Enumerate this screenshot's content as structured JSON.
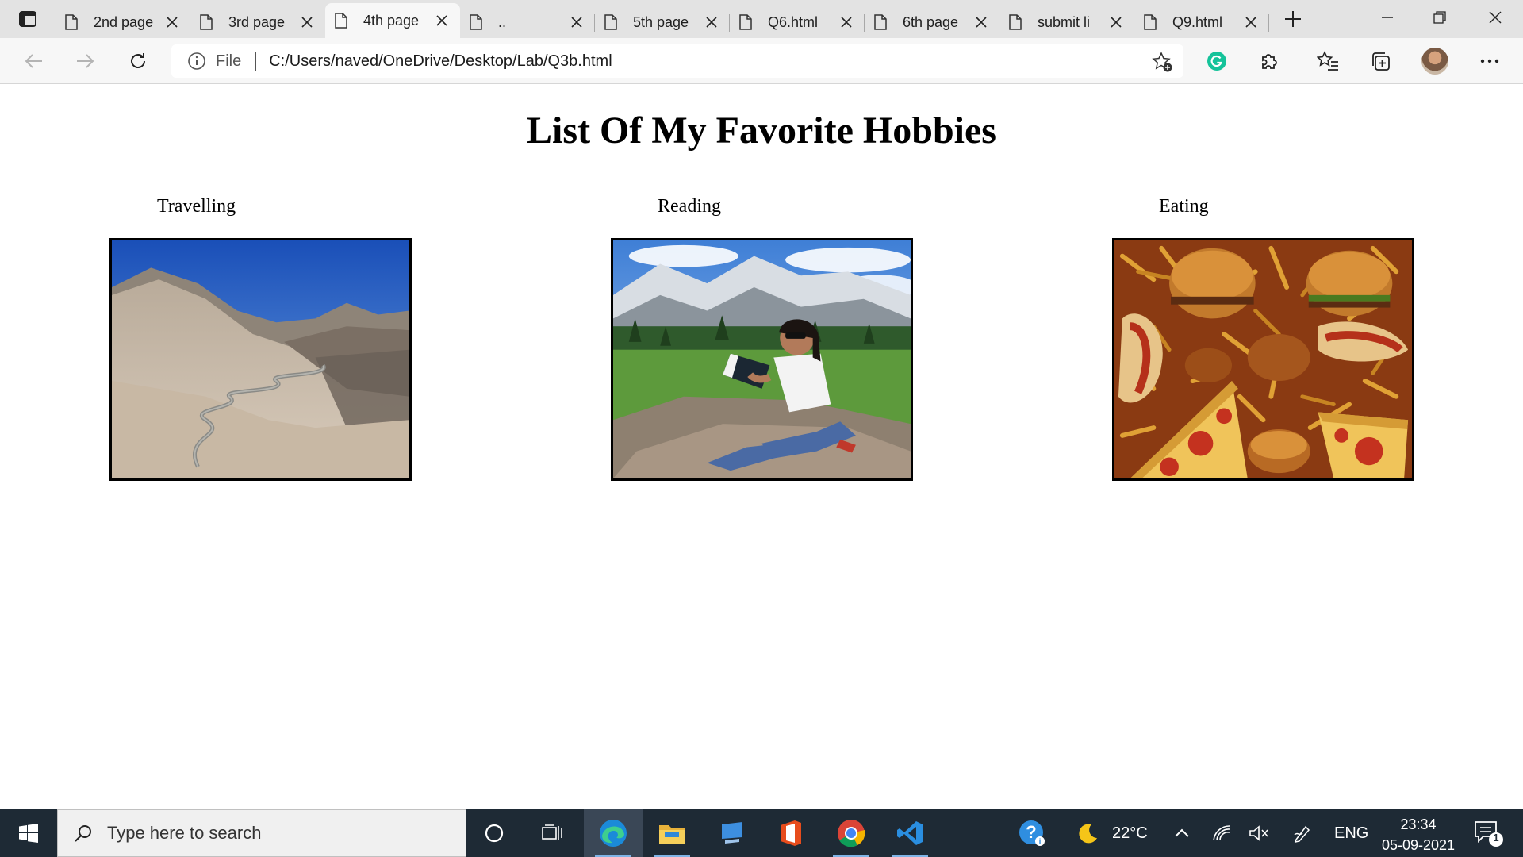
{
  "browser": {
    "tabs": [
      {
        "title": "2nd page",
        "active": false
      },
      {
        "title": "3rd page",
        "active": false
      },
      {
        "title": "4th page",
        "active": true
      },
      {
        "title": "..",
        "active": false
      },
      {
        "title": "5th page",
        "active": false
      },
      {
        "title": "Q6.html",
        "active": false
      },
      {
        "title": "6th page",
        "active": false
      },
      {
        "title": "submit li",
        "active": false
      },
      {
        "title": "Q9.html",
        "active": false
      }
    ],
    "address": {
      "scheme_label": "File",
      "url": "C:/Users/naved/OneDrive/Desktop/Lab/Q3b.html"
    }
  },
  "page": {
    "title": "List Of My Favorite Hobbies",
    "hobbies": [
      {
        "label": "Travelling",
        "image": "mountain-road-photo"
      },
      {
        "label": "Reading",
        "image": "girl-reading-photo"
      },
      {
        "label": "Eating",
        "image": "fast-food-photo"
      }
    ]
  },
  "taskbar": {
    "search_placeholder": "Type here to search",
    "pinned": [
      "cortana-icon",
      "task-view-icon",
      "edge-icon",
      "file-explorer-icon",
      "desktop-app-icon",
      "office-icon",
      "chrome-icon",
      "vscode-icon"
    ],
    "weather": {
      "temperature": "22°C"
    },
    "language": "ENG",
    "time": "23:34",
    "date": "05-09-2021",
    "notification_count": "1"
  },
  "colors": {
    "tab_strip": "#e3e3e3",
    "toolbar": "#f7f7f7",
    "taskbar": "#1e2a35",
    "grammarly": "#15c39a",
    "edge_blue": "#1b8ad8"
  }
}
